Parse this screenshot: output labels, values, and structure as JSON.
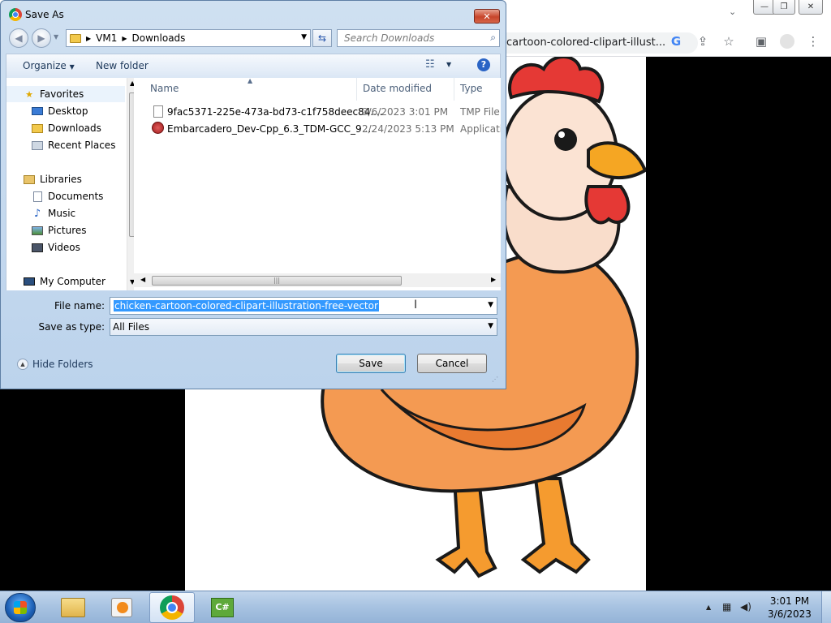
{
  "chrome": {
    "omnibox_text": "cartoon-colored-clipart-illust..."
  },
  "dialog": {
    "title": "Save As",
    "breadcrumb": [
      "VM1",
      "Downloads"
    ],
    "search_placeholder": "Search Downloads",
    "toolbar": {
      "organize": "Organize",
      "new_folder": "New folder"
    },
    "nav": {
      "favorites": "Favorites",
      "desktop": "Desktop",
      "downloads": "Downloads",
      "recent": "Recent Places",
      "libraries": "Libraries",
      "documents": "Documents",
      "music": "Music",
      "pictures": "Pictures",
      "videos": "Videos",
      "computer": "My Computer"
    },
    "columns": {
      "name": "Name",
      "date": "Date modified",
      "type": "Type"
    },
    "files": [
      {
        "name": "9fac5371-225e-473a-bd73-c1f758deec84....",
        "date": "3/6/2023 3:01 PM",
        "type": "TMP File"
      },
      {
        "name": "Embarcadero_Dev-Cpp_6.3_TDM-GCC_9....",
        "date": "2/24/2023 5:13 PM",
        "type": "Applicatio"
      }
    ],
    "file_name_label": "File name:",
    "file_name_value": "chicken-cartoon-colored-clipart-illustration-free-vector",
    "save_type_label": "Save as type:",
    "save_type_value": "All Files",
    "save_button": "Save",
    "cancel_button": "Cancel",
    "hide_folders": "Hide Folders"
  },
  "taskbar": {
    "time": "3:01 PM",
    "date": "3/6/2023"
  }
}
